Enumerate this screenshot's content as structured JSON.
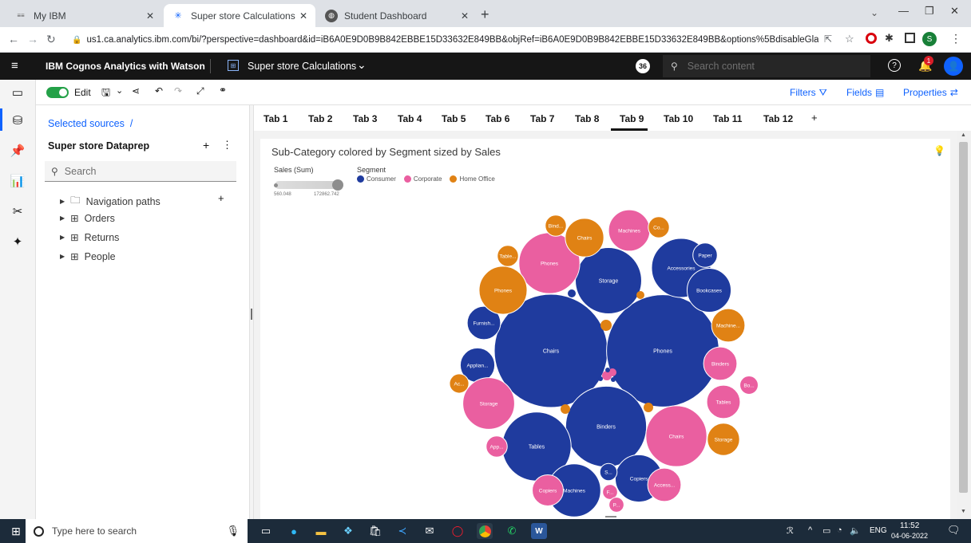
{
  "browser": {
    "tabs": [
      {
        "title": "My IBM",
        "favicon": "ibm-logo-icon"
      },
      {
        "title": "Super store Calculations",
        "favicon": "cognos-icon"
      },
      {
        "title": "Student Dashboard",
        "favicon": "globe-icon"
      }
    ],
    "new_tab": "+",
    "url": "us1.ca.analytics.ibm.com/bi/?perspective=dashboard&id=iB6A0E9D0B9B842EBBE15D33632E849BB&objRef=iB6A0E9D0B9B842EBBE15D33632E849BB&options%5BdisableGlassPrefetch..."
  },
  "app": {
    "title": "IBM Cognos Analytics with Watson",
    "report": "Super store Calculations",
    "badge": "36",
    "search_placeholder": "Search content",
    "notif_count": "1"
  },
  "toolbar": {
    "edit_label": "Edit",
    "filters": "Filters",
    "fields": "Fields",
    "properties": "Properties"
  },
  "sources": {
    "breadcrumb": "Selected sources  /",
    "name": "Super store Dataprep",
    "search_placeholder": "Search",
    "items": [
      "Navigation paths",
      "Orders",
      "Returns",
      "People"
    ]
  },
  "dash_tabs": [
    "Tab 1",
    "Tab 2",
    "Tab 3",
    "Tab 4",
    "Tab 5",
    "Tab 6",
    "Tab 7",
    "Tab 8",
    "Tab 9",
    "Tab 10",
    "Tab 11",
    "Tab 12"
  ],
  "add_tab": "+",
  "active_tab": "Tab 9",
  "chart_data": {
    "type": "packed-bubble",
    "title": "Sub-Category colored by Segment sized by Sales",
    "size_legend": {
      "label": "Sales (Sum)",
      "min": "560.048",
      "max": "172862.742"
    },
    "color_legend": {
      "label": "Segment",
      "items": [
        {
          "name": "Consumer",
          "color": "#1f3b9e"
        },
        {
          "name": "Corporate",
          "color": "#ea5fa0"
        },
        {
          "name": "Home Office",
          "color": "#e08214"
        }
      ]
    },
    "bubbles": [
      {
        "label": "Chairs",
        "segment": "Consumer",
        "value": 172862.742
      },
      {
        "label": "Phones",
        "segment": "Consumer",
        "value": 169933.5
      },
      {
        "label": "Binders",
        "segment": "Consumer",
        "value": 88000
      },
      {
        "label": "Tables",
        "segment": "Consumer",
        "value": 64000
      },
      {
        "label": "Storage",
        "segment": "Consumer",
        "value": 59000
      },
      {
        "label": "Accessories",
        "segment": "Consumer",
        "value": 47000
      },
      {
        "label": "Machines",
        "segment": "Consumer",
        "value": 38000
      },
      {
        "label": "Copiers",
        "segment": "Consumer",
        "value": 30000
      },
      {
        "label": "Bookcases",
        "segment": "Consumer",
        "value": 26000
      },
      {
        "label": "Applian...",
        "segment": "Consumer",
        "value": 16000
      },
      {
        "label": "Furnish...",
        "segment": "Consumer",
        "value": 15000
      },
      {
        "label": "Paper",
        "segment": "Consumer",
        "value": 8000
      },
      {
        "label": "S...",
        "segment": "Consumer",
        "value": 4000
      },
      {
        "label": "Phones",
        "segment": "Corporate",
        "value": 50000
      },
      {
        "label": "Chairs",
        "segment": "Corporate",
        "value": 50000
      },
      {
        "label": "Storage",
        "segment": "Corporate",
        "value": 36000
      },
      {
        "label": "Machines",
        "segment": "Corporate",
        "value": 23000
      },
      {
        "label": "Binders",
        "segment": "Corporate",
        "value": 15000
      },
      {
        "label": "Tables",
        "segment": "Corporate",
        "value": 15000
      },
      {
        "label": "Access...",
        "segment": "Corporate",
        "value": 15000
      },
      {
        "label": "Copiers",
        "segment": "Corporate",
        "value": 13000
      },
      {
        "label": "App...",
        "segment": "Corporate",
        "value": 6000
      },
      {
        "label": "Bo...",
        "segment": "Corporate",
        "value": 4500
      },
      {
        "label": "F...",
        "segment": "Corporate",
        "value": 3000
      },
      {
        "label": "P...",
        "segment": "Corporate",
        "value": 3000
      },
      {
        "label": "Phones",
        "segment": "Home Office",
        "value": 31000
      },
      {
        "label": "Chairs",
        "segment": "Home Office",
        "value": 20000
      },
      {
        "label": "Machine...",
        "segment": "Home Office",
        "value": 15000
      },
      {
        "label": "Storage",
        "segment": "Home Office",
        "value": 14000
      },
      {
        "label": "Table...",
        "segment": "Home Office",
        "value": 6000
      },
      {
        "label": "Bind...",
        "segment": "Home Office",
        "value": 6000
      },
      {
        "label": "Co...",
        "segment": "Home Office",
        "value": 6000
      },
      {
        "label": "Ac...",
        "segment": "Home Office",
        "value": 5000
      }
    ]
  },
  "taskbar": {
    "search_placeholder": "Type here to search",
    "lang": "ENG",
    "time": "11:52",
    "date": "04-06-2022"
  }
}
